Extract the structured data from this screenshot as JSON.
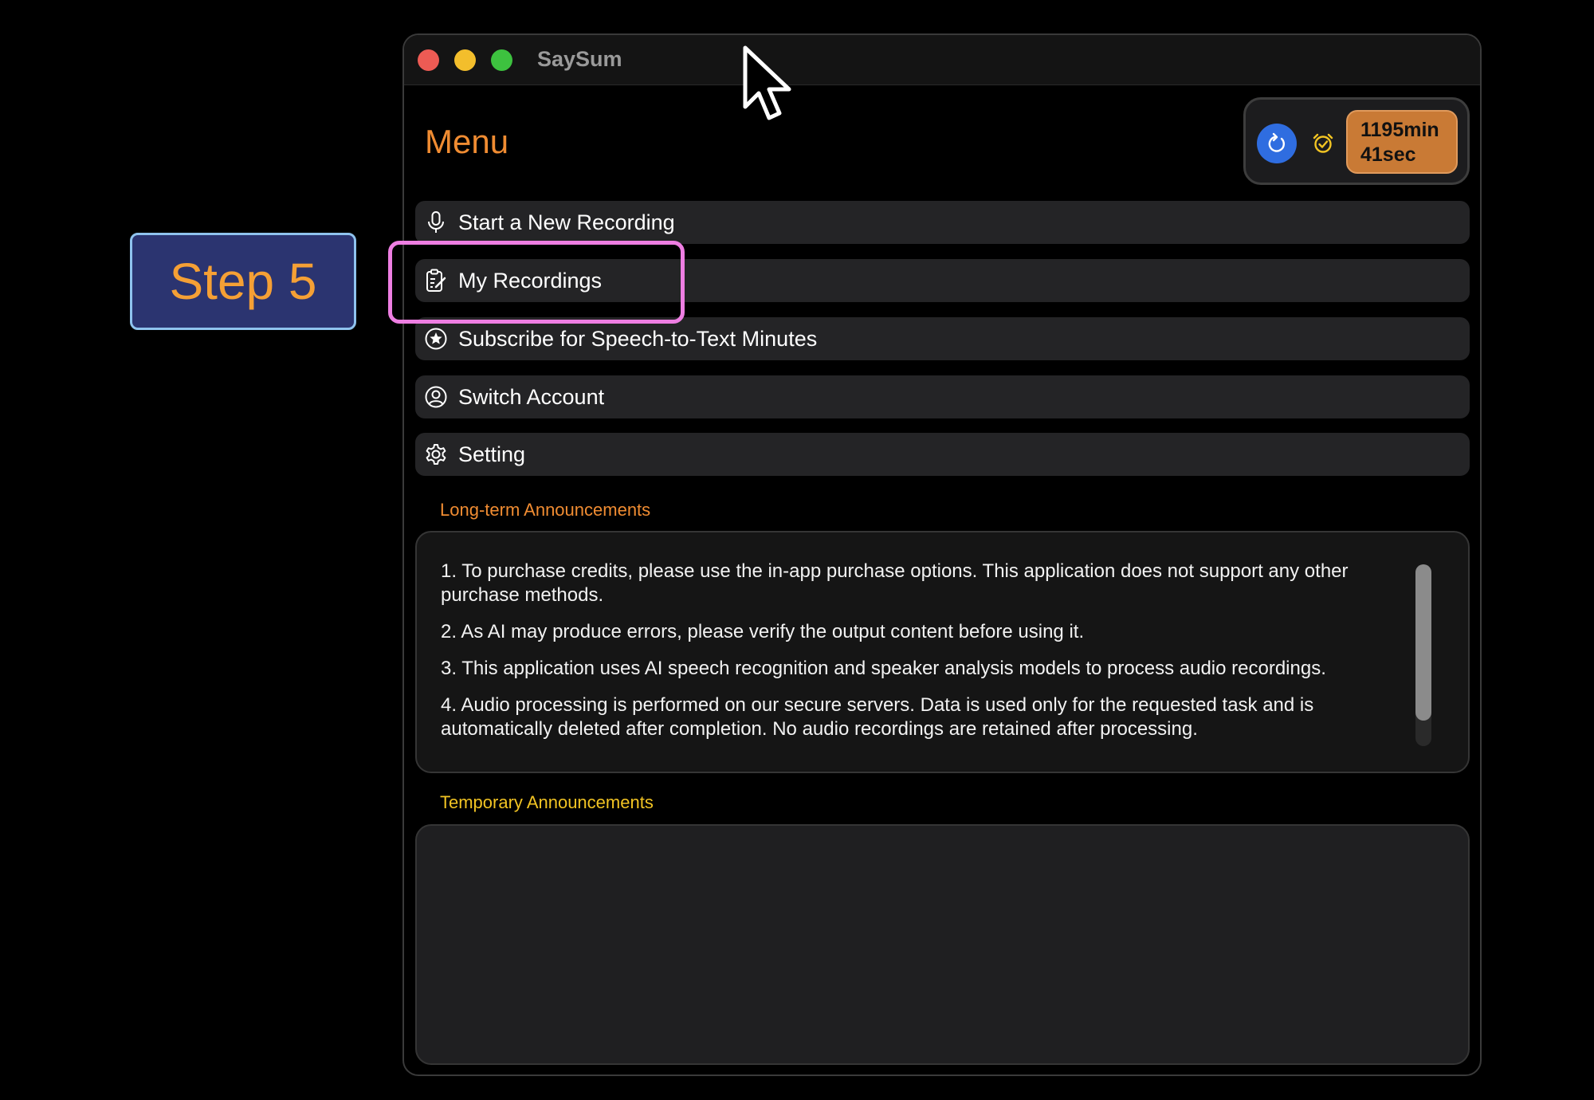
{
  "step_badge": {
    "label": "Step 5"
  },
  "window": {
    "title": "SaySum"
  },
  "header": {
    "menu_title": "Menu",
    "balance_minutes": "1195min",
    "balance_seconds": "41sec",
    "refresh_icon": "refresh-icon",
    "timer_icon": "timer-icon"
  },
  "menu": {
    "items": [
      {
        "label": "Start a New Recording",
        "icon": "microphone-icon"
      },
      {
        "label": "My Recordings",
        "icon": "clipboard-edit-icon"
      },
      {
        "label": "Subscribe for Speech-to-Text Minutes",
        "icon": "star-circle-icon"
      },
      {
        "label": "Switch Account",
        "icon": "person-circle-icon"
      },
      {
        "label": "Setting",
        "icon": "gear-icon"
      }
    ]
  },
  "announcements": {
    "long_term_label": "Long-term Announcements",
    "long_term_items": [
      "1. To purchase credits, please use the in-app purchase options. This application does not support any other purchase methods.",
      "2. As AI may produce errors, please verify the output content before using it.",
      "3. This application uses AI speech recognition and speaker analysis models to process audio recordings.",
      "4. Audio processing is performed on our secure servers. Data is used only for the requested task and is automatically deleted after completion. No audio recordings are retained after processing."
    ],
    "temporary_label": "Temporary Announcements"
  },
  "colors": {
    "accent_orange": "#f08c32",
    "accent_yellow": "#f2c423",
    "highlight_pink": "#ee7ee2",
    "refresh_blue": "#2f6de0",
    "badge_orange": "#c97a35",
    "step_badge_bg": "#2b3470"
  }
}
